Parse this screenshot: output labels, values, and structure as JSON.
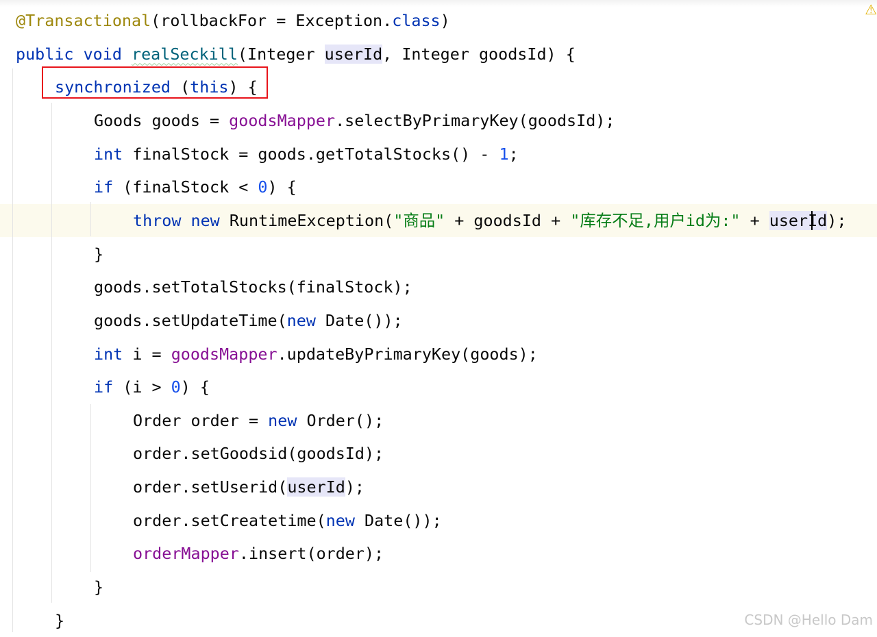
{
  "editor": {
    "lines": [
      {
        "indent": 0,
        "tokens": [
          {
            "t": "@Transactional",
            "c": "ann"
          },
          {
            "t": "(rollbackFor = Exception."
          },
          {
            "t": "class",
            "c": "kw"
          },
          {
            "t": ")"
          }
        ]
      },
      {
        "indent": 0,
        "tokens": [
          {
            "t": "public void ",
            "c": "kw"
          },
          {
            "t": "realSeckill",
            "c": "mdecl"
          },
          {
            "t": "(Integer "
          },
          {
            "t": "userId",
            "c": "hl"
          },
          {
            "t": ", Integer goodsId) {"
          }
        ]
      },
      {
        "indent": 1,
        "tokens": [
          {
            "t": "synchronized ",
            "c": "kw"
          },
          {
            "t": "("
          },
          {
            "t": "this",
            "c": "kw"
          },
          {
            "t": ") {"
          }
        ]
      },
      {
        "indent": 2,
        "tokens": [
          {
            "t": "Goods goods = "
          },
          {
            "t": "goodsMapper",
            "c": "fld"
          },
          {
            "t": ".selectByPrimaryKey(goodsId);"
          }
        ]
      },
      {
        "indent": 2,
        "tokens": [
          {
            "t": "int ",
            "c": "kw"
          },
          {
            "t": "finalStock = goods.getTotalStocks() - "
          },
          {
            "t": "1",
            "c": "num"
          },
          {
            "t": ";"
          }
        ]
      },
      {
        "indent": 2,
        "tokens": [
          {
            "t": "if ",
            "c": "kw"
          },
          {
            "t": "(finalStock < "
          },
          {
            "t": "0",
            "c": "num"
          },
          {
            "t": ") {"
          }
        ]
      },
      {
        "indent": 3,
        "current": true,
        "tokens": [
          {
            "t": "throw new ",
            "c": "kw"
          },
          {
            "t": "RuntimeException("
          },
          {
            "t": "\"商品\"",
            "c": "str"
          },
          {
            "t": " + goodsId + "
          },
          {
            "t": "\"库存不足,用户id为:\"",
            "c": "str"
          },
          {
            "t": " + "
          },
          {
            "t": "userId",
            "c": "hl"
          },
          {
            "t": ");"
          }
        ]
      },
      {
        "indent": 2,
        "tokens": [
          {
            "t": "}"
          }
        ]
      },
      {
        "indent": 2,
        "tokens": [
          {
            "t": "goods.setTotalStocks(finalStock);"
          }
        ]
      },
      {
        "indent": 2,
        "tokens": [
          {
            "t": "goods.setUpdateTime("
          },
          {
            "t": "new ",
            "c": "kw"
          },
          {
            "t": "Date());"
          }
        ]
      },
      {
        "indent": 2,
        "tokens": [
          {
            "t": "int ",
            "c": "kw"
          },
          {
            "t": "i = "
          },
          {
            "t": "goodsMapper",
            "c": "fld"
          },
          {
            "t": ".updateByPrimaryKey(goods);"
          }
        ]
      },
      {
        "indent": 2,
        "tokens": [
          {
            "t": "if ",
            "c": "kw"
          },
          {
            "t": "(i > "
          },
          {
            "t": "0",
            "c": "num"
          },
          {
            "t": ") {"
          }
        ]
      },
      {
        "indent": 3,
        "tokens": [
          {
            "t": "Order order = "
          },
          {
            "t": "new ",
            "c": "kw"
          },
          {
            "t": "Order();"
          }
        ]
      },
      {
        "indent": 3,
        "tokens": [
          {
            "t": "order.setGoodsid(goodsId);"
          }
        ]
      },
      {
        "indent": 3,
        "tokens": [
          {
            "t": "order.setUserid("
          },
          {
            "t": "userId",
            "c": "hl"
          },
          {
            "t": ");"
          }
        ]
      },
      {
        "indent": 3,
        "tokens": [
          {
            "t": "order.setCreatetime("
          },
          {
            "t": "new ",
            "c": "kw"
          },
          {
            "t": "Date());"
          }
        ]
      },
      {
        "indent": 3,
        "tokens": [
          {
            "t": "orderMapper",
            "c": "fld"
          },
          {
            "t": ".insert(order);"
          }
        ]
      },
      {
        "indent": 2,
        "tokens": [
          {
            "t": "}"
          }
        ]
      },
      {
        "indent": 1,
        "tokens": [
          {
            "t": "}"
          }
        ]
      }
    ],
    "warning_icon": "warning-triangle-icon",
    "colors": {
      "keyword": "#0033b3",
      "annotation": "#9e880d",
      "field": "#871094",
      "string": "#067d17",
      "number": "#1750eb",
      "method": "#00627a",
      "highlight_box": "#e8141b"
    }
  },
  "watermark": "CSDN @Hello Dam"
}
